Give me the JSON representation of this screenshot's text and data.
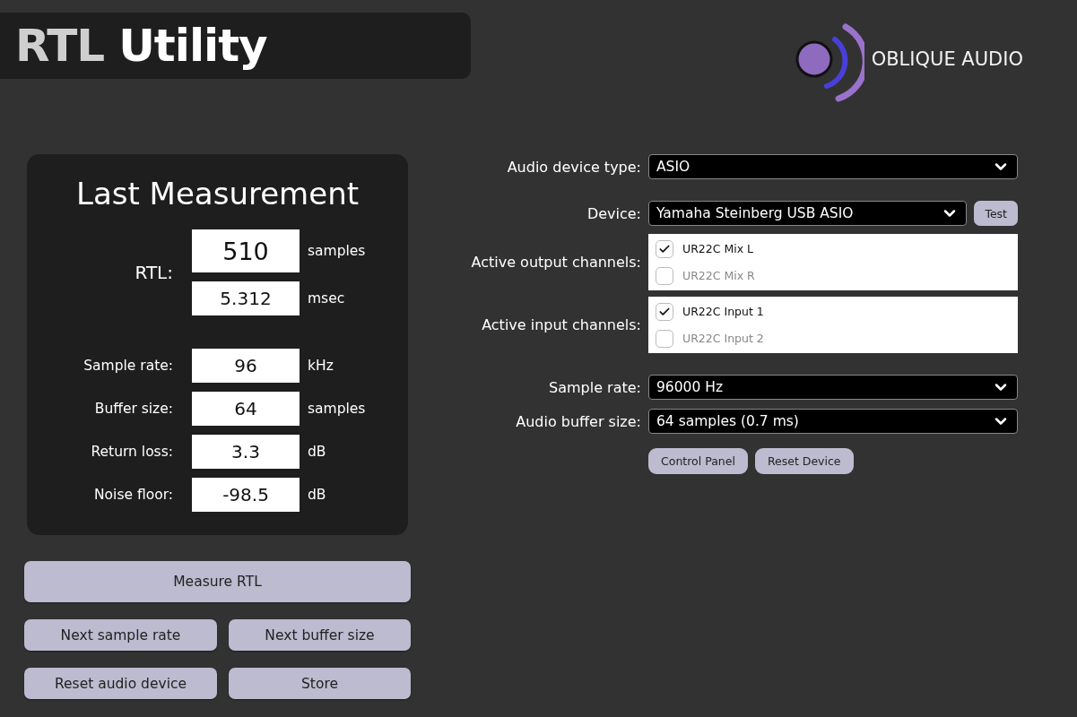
{
  "header": {
    "title": [
      {
        "text": "RTL",
        "kind": "dim"
      },
      {
        "text": "Utility",
        "kind": "bright"
      }
    ],
    "brand": "OBLIQUE AUDIO"
  },
  "measurement": {
    "title": "Last Measurement",
    "rtl_label": "RTL:",
    "rtl": [
      {
        "value": "510",
        "unit": "samples"
      },
      {
        "value": "5.312",
        "unit": "msec"
      }
    ],
    "rows": [
      {
        "label": "Sample rate:",
        "value": "96",
        "unit": "kHz"
      },
      {
        "label": "Buffer size:",
        "value": "64",
        "unit": "samples"
      },
      {
        "label": "Return loss:",
        "value": "3.3",
        "unit": "dB"
      },
      {
        "label": "Noise floor:",
        "value": "-98.5",
        "unit": "dB"
      }
    ]
  },
  "actions": {
    "primary": "Measure RTL",
    "buttons": [
      "Next sample rate",
      "Next buffer size",
      "Reset audio device",
      "Store"
    ]
  },
  "settings": {
    "rows": [
      {
        "kind": "dropdown",
        "label": "Audio device type:",
        "value": "ASIO"
      },
      {
        "kind": "dropdown",
        "label": "Device:",
        "value": "Yamaha Steinberg USB ASIO",
        "button": "Test"
      },
      {
        "kind": "channels",
        "label": "Active output channels:",
        "channels": [
          {
            "name": "UR22C Mix L",
            "checked": true
          },
          {
            "name": "UR22C Mix R",
            "checked": false
          }
        ]
      },
      {
        "kind": "channels",
        "label": "Active input channels:",
        "channels": [
          {
            "name": "UR22C Input 1",
            "checked": true
          },
          {
            "name": "UR22C Input 2",
            "checked": false
          }
        ]
      },
      {
        "kind": "dropdown",
        "label": "Sample rate:",
        "value": "96000 Hz"
      },
      {
        "kind": "dropdown",
        "label": "Audio buffer size:",
        "value": "64 samples (0.7 ms)"
      }
    ],
    "buttons": [
      "Control Panel",
      "Reset Device"
    ]
  }
}
